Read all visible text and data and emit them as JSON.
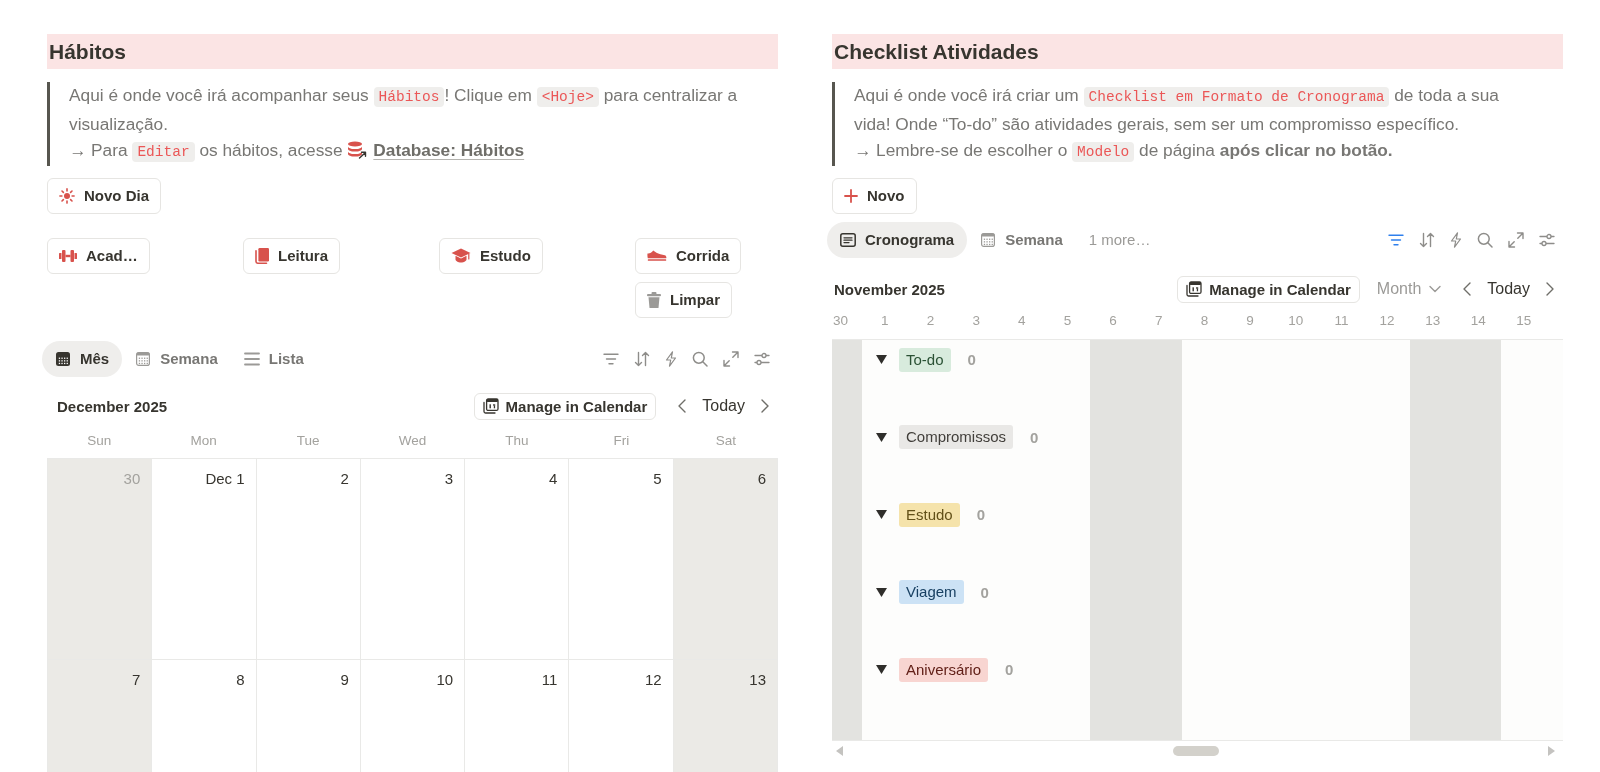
{
  "habits": {
    "title": "Hábitos",
    "callout": [
      [
        {
          "kind": "text",
          "text": "Aqui é onde você irá acompanhar seus "
        },
        {
          "kind": "code",
          "text": "Hábitos"
        },
        {
          "kind": "text",
          "text": "! Clique em "
        },
        {
          "kind": "code",
          "text": "<Hoje>"
        },
        {
          "kind": "text",
          "text": " para centralizar a visualização."
        }
      ],
      [
        {
          "kind": "text",
          "text": "→ Para "
        },
        {
          "kind": "code",
          "text": "Editar"
        },
        {
          "kind": "text",
          "text": " os hábitos, acesse "
        },
        {
          "kind": "link",
          "text": "Database: Hábitos"
        }
      ]
    ],
    "new_button": {
      "label": "Novo Dia",
      "kind": "sun"
    },
    "habit_columns": [
      {
        "buttons": [
          {
            "label": "Acad…",
            "kind": "dumbbell"
          }
        ]
      },
      {
        "buttons": [
          {
            "label": "Leitura",
            "kind": "book"
          }
        ]
      },
      {
        "buttons": [
          {
            "label": "Estudo",
            "kind": "cap"
          }
        ]
      },
      {
        "buttons": [
          {
            "label": "Corrida",
            "kind": "shoe"
          },
          {
            "label": "Limpar",
            "kind": "trash"
          }
        ]
      }
    ],
    "view_tabs": [
      {
        "label": "Mês",
        "kind": "calendar",
        "selected": true
      },
      {
        "label": "Semana",
        "kind": "calendar",
        "selected": false
      },
      {
        "label": "Lista",
        "kind": "list",
        "selected": false
      }
    ],
    "toolbar": [
      {
        "kind": "filter",
        "active": false
      },
      {
        "kind": "sort",
        "active": false
      },
      {
        "kind": "automation",
        "active": false
      },
      {
        "kind": "search",
        "active": false
      },
      {
        "kind": "expand",
        "active": false
      },
      {
        "kind": "settings",
        "active": false
      }
    ],
    "calendar": {
      "title": "December 2025",
      "manage_button": "Manage in Calendar",
      "today_button": "Today",
      "weekdays": [
        "Sun",
        "Mon",
        "Tue",
        "Wed",
        "Thu",
        "Fri",
        "Sat"
      ],
      "weeks": [
        {
          "days": [
            {
              "label": "30",
              "muted": true,
              "shaded": true
            },
            {
              "label": "Dec 1",
              "muted": false,
              "shaded": false
            },
            {
              "label": "2",
              "muted": false,
              "shaded": false
            },
            {
              "label": "3",
              "muted": false,
              "shaded": false
            },
            {
              "label": "4",
              "muted": false,
              "shaded": false
            },
            {
              "label": "5",
              "muted": false,
              "shaded": false
            },
            {
              "label": "6",
              "muted": false,
              "shaded": true
            }
          ]
        },
        {
          "days": [
            {
              "label": "7",
              "muted": false,
              "shaded": true
            },
            {
              "label": "8",
              "muted": false,
              "shaded": false
            },
            {
              "label": "9",
              "muted": false,
              "shaded": false
            },
            {
              "label": "10",
              "muted": false,
              "shaded": false
            },
            {
              "label": "11",
              "muted": false,
              "shaded": false
            },
            {
              "label": "12",
              "muted": false,
              "shaded": false
            },
            {
              "label": "13",
              "muted": false,
              "shaded": true
            }
          ]
        }
      ]
    }
  },
  "checklist": {
    "title": "Checklist Atividades",
    "callout": [
      [
        {
          "kind": "text",
          "text": "Aqui é onde você irá criar um "
        },
        {
          "kind": "code",
          "text": "Checklist em Formato de Cronograma"
        },
        {
          "kind": "text",
          "text": " de toda a sua vida! Onde “To-do” são atividades gerais, sem ser um compromisso específico."
        }
      ],
      [
        {
          "kind": "text",
          "text": "→ Lembre-se de escolher o "
        },
        {
          "kind": "code",
          "text": "Modelo"
        },
        {
          "kind": "text",
          "text": " de página **após clicar no botão.**"
        }
      ]
    ],
    "new_button": {
      "label": "Novo",
      "kind": "plus"
    },
    "view_tabs": [
      {
        "label": "Cronograma",
        "kind": "timeline",
        "selected": true
      },
      {
        "label": "Semana",
        "kind": "calendar",
        "selected": false
      },
      {
        "label": "1 more…",
        "kind": "more",
        "selected": false
      }
    ],
    "toolbar": [
      {
        "kind": "filter",
        "active": true
      },
      {
        "kind": "sort",
        "active": false
      },
      {
        "kind": "automation",
        "active": false
      },
      {
        "kind": "search",
        "active": false
      },
      {
        "kind": "expand",
        "active": false
      },
      {
        "kind": "settings",
        "active": false
      }
    ],
    "timeline": {
      "title": "November 2025",
      "manage_button": "Manage in Calendar",
      "range": "Month",
      "today_button": "Today",
      "days": [
        {
          "label": "30",
          "shaded": true
        },
        {
          "label": "1",
          "shaded": false
        },
        {
          "label": "2",
          "shaded": false
        },
        {
          "label": "3",
          "shaded": false
        },
        {
          "label": "4",
          "shaded": false
        },
        {
          "label": "5",
          "shaded": false
        },
        {
          "label": "6",
          "shaded": true
        },
        {
          "label": "7",
          "shaded": true
        },
        {
          "label": "8",
          "shaded": false
        },
        {
          "label": "9",
          "shaded": false
        },
        {
          "label": "10",
          "shaded": false
        },
        {
          "label": "11",
          "shaded": false
        },
        {
          "label": "12",
          "shaded": false
        },
        {
          "label": "13",
          "shaded": true
        },
        {
          "label": "14",
          "shaded": true
        },
        {
          "label": "15",
          "shaded": false
        }
      ],
      "groups": [
        {
          "label": "To-do",
          "color": "#d8ebdd",
          "count": "0",
          "expanded": true
        },
        {
          "label": "Compromissos",
          "color": "#e9e8e6",
          "count": "0",
          "expanded": true
        },
        {
          "label": "Estudo",
          "color": "#f5e3ab",
          "count": "0",
          "expanded": true
        },
        {
          "label": "Viagem",
          "color": "#cce2f5",
          "count": "0",
          "expanded": true
        },
        {
          "label": "Aniversário",
          "color": "#f8d5d1",
          "count": "0",
          "expanded": true
        }
      ]
    }
  }
}
